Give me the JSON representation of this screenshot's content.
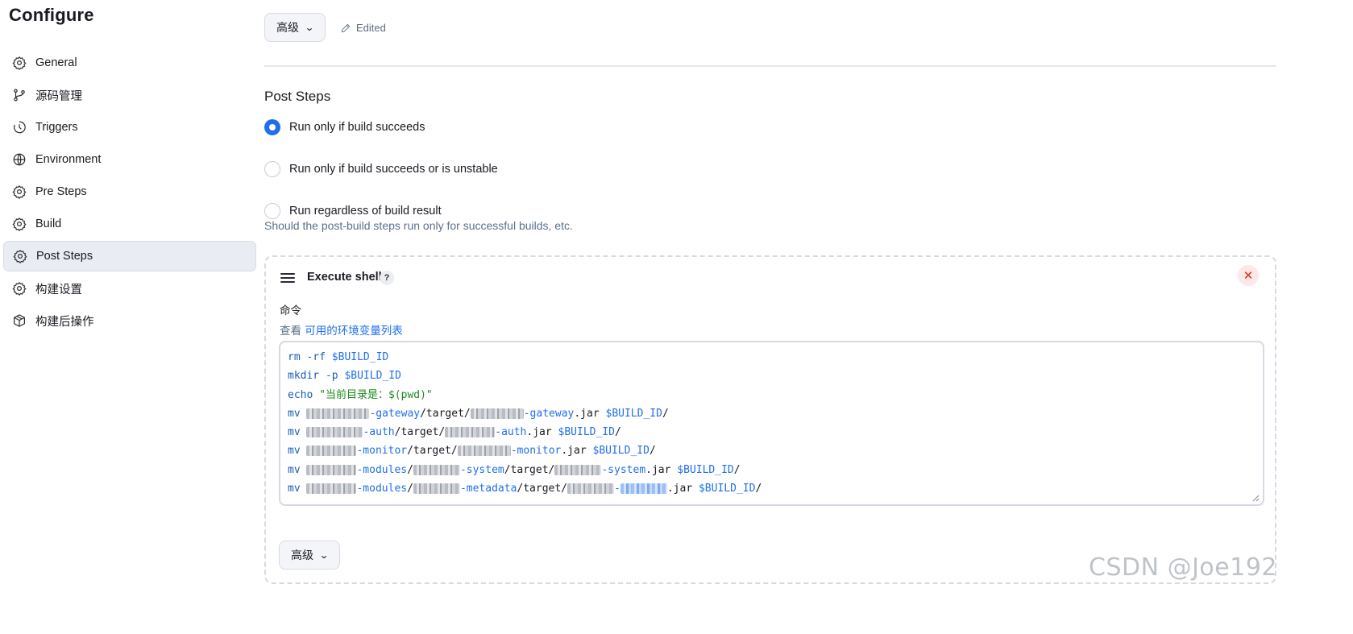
{
  "sidebar": {
    "title": "Configure",
    "items": [
      {
        "label": "General",
        "icon": "gear-icon"
      },
      {
        "label": "源码管理",
        "icon": "branch-icon"
      },
      {
        "label": "Triggers",
        "icon": "clock-icon"
      },
      {
        "label": "Environment",
        "icon": "globe-icon"
      },
      {
        "label": "Pre Steps",
        "icon": "gear-icon"
      },
      {
        "label": "Build",
        "icon": "gear-icon"
      },
      {
        "label": "Post Steps",
        "icon": "gear-icon",
        "active": true
      },
      {
        "label": "构建设置",
        "icon": "gear-icon"
      },
      {
        "label": "构建后操作",
        "icon": "package-icon"
      }
    ]
  },
  "top": {
    "advanced_label": "高级",
    "edited_label": "Edited"
  },
  "post_steps": {
    "title": "Post Steps",
    "options": [
      {
        "label": "Run only if build succeeds",
        "checked": true
      },
      {
        "label": "Run only if build succeeds or is unstable",
        "checked": false
      },
      {
        "label": "Run regardless of build result",
        "checked": false
      }
    ],
    "help": "Should the post-build steps run only for successful builds, etc."
  },
  "shell": {
    "title": "Execute shell",
    "help_label": "?",
    "close_label": "✕",
    "command_label": "命令",
    "env_prefix": "查看 ",
    "env_link": "可用的环境变量列表",
    "lines": {
      "l1": {
        "cmd": "rm",
        "arg": " -rf ",
        "var": "$BUILD_ID"
      },
      "l2": {
        "cmd": "mkdir",
        "arg": " -p ",
        "var": "$BUILD_ID"
      },
      "l3": {
        "cmd": "echo",
        "str": " \"当前目录是：$(pwd)\""
      },
      "l4": {
        "cmd": "mv",
        "s1": "-gateway",
        "mid": "/target/",
        "s2": "-gateway",
        "ext": ".jar ",
        "var": "$BUILD_ID",
        "end": "/"
      },
      "l5": {
        "cmd": "mv",
        "s1": "-auth",
        "mid": "/target/",
        "s2": "-auth",
        "ext": ".jar ",
        "var": "$BUILD_ID",
        "end": "/"
      },
      "l6": {
        "cmd": "mv",
        "s1": "-monitor",
        "mid": "/target/",
        "s2": "-monitor",
        "ext": ".jar ",
        "var": "$BUILD_ID",
        "end": "/"
      },
      "l7": {
        "cmd": "mv",
        "s1": "-modules",
        "sep": "/",
        "s2": "-system",
        "mid": "/target/",
        "s3": "-system",
        "ext": ".jar ",
        "var": "$BUILD_ID",
        "end": "/"
      },
      "l8": {
        "cmd": "mv",
        "s1": "-modules",
        "sep": "/",
        "s2": "-metadata",
        "mid": "/target/",
        "s3": "-",
        "ext": ".jar ",
        "var": "$BUILD_ID",
        "end": "/"
      }
    },
    "advanced_label": "高级"
  },
  "watermark": "CSDN @Joe192"
}
